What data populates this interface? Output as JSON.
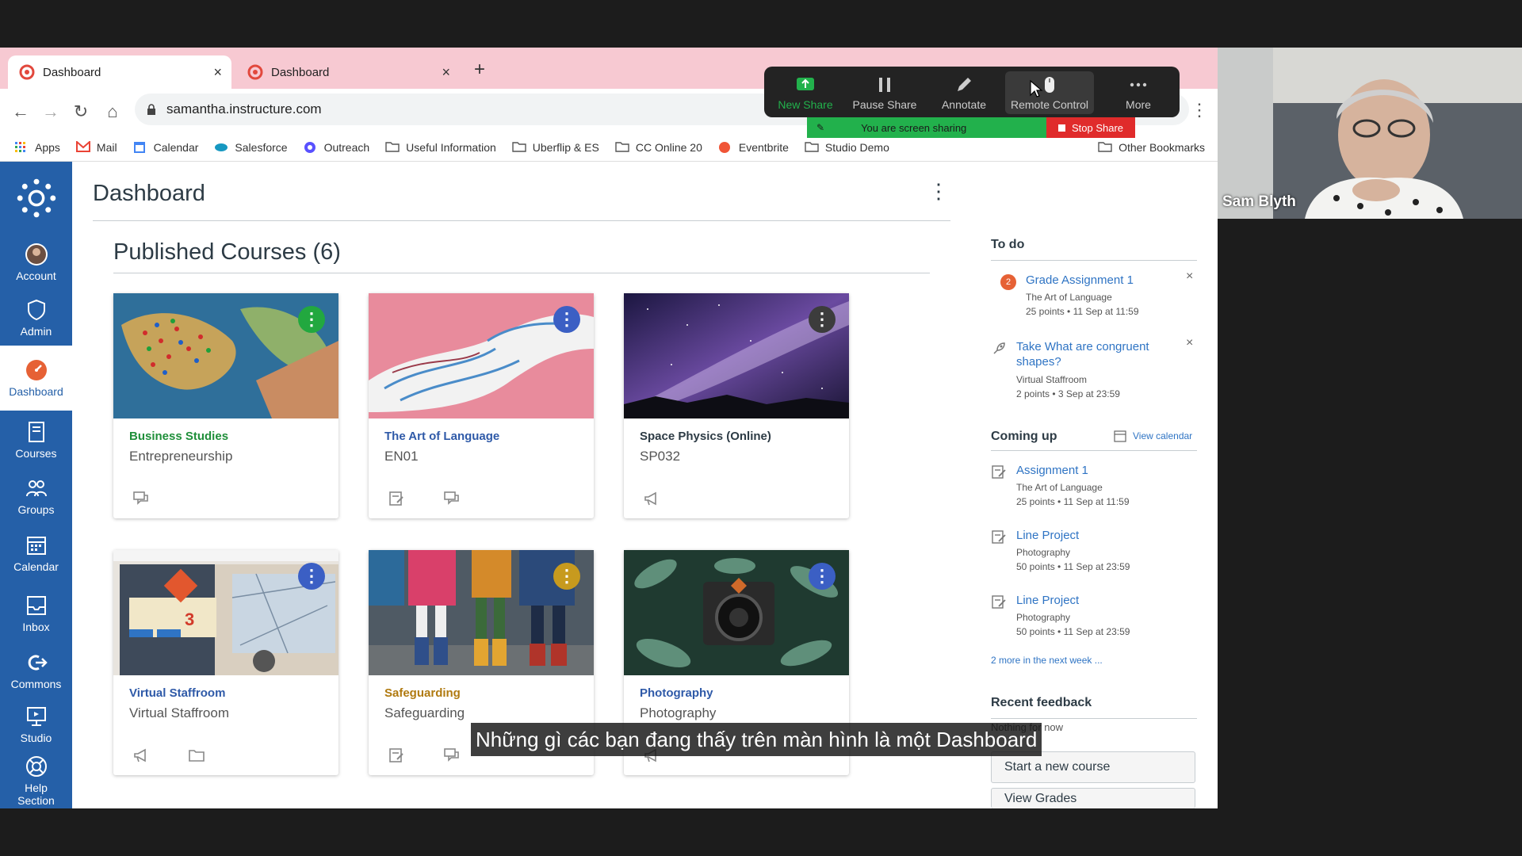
{
  "browser": {
    "tabs": [
      {
        "title": "Dashboard",
        "active": true
      },
      {
        "title": "Dashboard",
        "active": false
      }
    ],
    "newtab": "+",
    "url": "samantha.instructure.com",
    "bookmarks": [
      "Apps",
      "Mail",
      "Calendar",
      "Salesforce",
      "Outreach",
      "Useful Information",
      "Uberflip & ES",
      "CC Online 20",
      "Eventbrite",
      "Studio Demo",
      "Other Bookmarks"
    ],
    "close_glyph": "×"
  },
  "zoom": {
    "buttons": [
      {
        "label": "New Share",
        "icon": "share-up-icon",
        "color": "#22b14c"
      },
      {
        "label": "Pause Share",
        "icon": "pause-icon"
      },
      {
        "label": "Annotate",
        "icon": "pencil-icon"
      },
      {
        "label": "Remote Control",
        "icon": "mouse-icon"
      },
      {
        "label": "More",
        "icon": "more-dots-icon"
      }
    ],
    "status": "You are screen sharing",
    "stop": "Stop Share",
    "participant": "Sam Blyth"
  },
  "nav": {
    "items": [
      {
        "label": "Account",
        "icon": "avatar"
      },
      {
        "label": "Admin",
        "icon": "shield-icon"
      },
      {
        "label": "Dashboard",
        "icon": "dashboard-icon",
        "active": true
      },
      {
        "label": "Courses",
        "icon": "book-icon"
      },
      {
        "label": "Groups",
        "icon": "groups-icon"
      },
      {
        "label": "Calendar",
        "icon": "calendar-icon"
      },
      {
        "label": "Inbox",
        "icon": "inbox-icon"
      },
      {
        "label": "Commons",
        "icon": "commons-icon"
      },
      {
        "label": "Studio",
        "icon": "studio-icon"
      },
      {
        "label": "Help",
        "label2": "Section",
        "icon": "help-icon"
      }
    ]
  },
  "dashboard": {
    "title": "Dashboard",
    "menu": "⋮",
    "published": "Published Courses (6)",
    "courses": [
      {
        "name": "Business Studies",
        "code": "Entrepreneurship",
        "color": "#1f8f3a",
        "kebab": "#22a83f"
      },
      {
        "name": "The Art of Language",
        "code": "EN01",
        "color": "#2f5aa8",
        "kebab": "#3b5fc4"
      },
      {
        "name": "Space Physics (Online)",
        "code": "SP032",
        "color": "#2d3b45",
        "kebab": "#3c3c3c"
      },
      {
        "name": "Virtual Staffroom",
        "code": "Virtual Staffroom",
        "color": "#2f5aa8",
        "kebab": "#3b5fc4"
      },
      {
        "name": "Safeguarding",
        "code": "Safeguarding",
        "color": "#b07a10",
        "kebab": "#c79a1e"
      },
      {
        "name": "Photography",
        "code": "Photography",
        "color": "#2f5aa8",
        "kebab": "#3b5fc4"
      }
    ]
  },
  "sidebar": {
    "todo_head": "To do",
    "todo": [
      {
        "badge": "2",
        "title": "Grade Assignment 1",
        "sub": "The Art of Language",
        "meta": "25 points • 11 Sep at 11:59"
      },
      {
        "title": "Take What are congruent shapes?",
        "sub": "Virtual Staffroom",
        "meta": "2 points • 3 Sep at 23:59"
      }
    ],
    "coming_head": "Coming up",
    "view_calendar": "View calendar",
    "coming": [
      {
        "title": "Assignment 1",
        "sub": "The Art of Language",
        "meta": "25 points • 11 Sep at 11:59"
      },
      {
        "title": "Line Project",
        "sub": "Photography",
        "meta": "50 points • 11 Sep at 23:59"
      },
      {
        "title": "Line Project",
        "sub": "Photography",
        "meta": "50 points • 11 Sep at 23:59"
      }
    ],
    "more": "2 more in the next week ...",
    "feedback_head": "Recent feedback",
    "feedback_none": "Nothing for now",
    "start_course": "Start a new course",
    "view_grades": "View Grades"
  },
  "subtitle": "Những gì các bạn đang thấy trên màn hình là một Dashboard"
}
